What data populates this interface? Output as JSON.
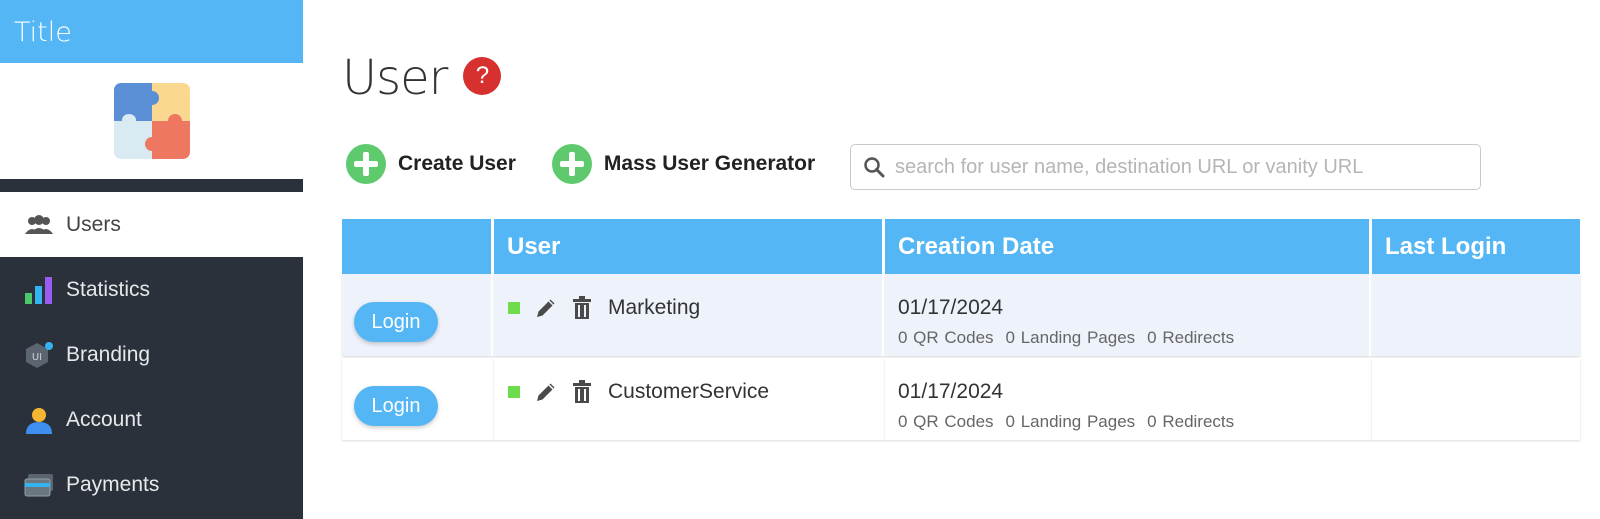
{
  "sidebar": {
    "title": "Title",
    "items": [
      {
        "label": "Users",
        "icon": "users-icon",
        "active": true
      },
      {
        "label": "Statistics",
        "icon": "bar-chart-icon"
      },
      {
        "label": "Branding",
        "icon": "branding-icon"
      },
      {
        "label": "Account",
        "icon": "person-icon"
      },
      {
        "label": "Payments",
        "icon": "credit-card-icon"
      }
    ]
  },
  "main": {
    "title": "User",
    "help": "?",
    "create_user": "Create User",
    "mass_user_generator": "Mass User Generator",
    "search_placeholder": "search for user name, destination URL or vanity URL",
    "table": {
      "headers": [
        "",
        "User",
        "Creation Date",
        "Last Login"
      ],
      "rows": [
        {
          "login": "Login",
          "user": "Marketing",
          "created": "01/17/2024",
          "qr": "0 QR Codes",
          "landing": "0 Landing Pages",
          "redirects": "0 Redirects",
          "last_login": ""
        },
        {
          "login": "Login",
          "user": "CustomerService",
          "created": "01/17/2024",
          "qr": "0 QR Codes",
          "landing": "0 Landing Pages",
          "redirects": "0 Redirects",
          "last_login": ""
        }
      ]
    }
  },
  "colors": {
    "accent": "#54b6f5",
    "sidebar_bg": "#2a313a",
    "add_green": "#5fc96d",
    "help_red": "#d6312f",
    "status_green": "#6fdd4b"
  }
}
